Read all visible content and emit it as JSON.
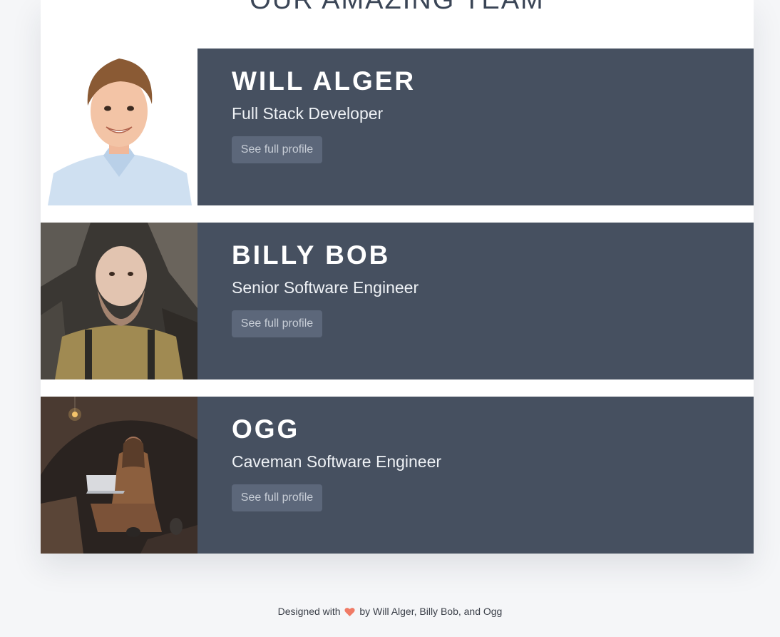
{
  "page": {
    "title": "OUR AMAZING TEAM"
  },
  "team": [
    {
      "name": "WILL ALGER",
      "role": "Full Stack Developer",
      "button_label": "See full profile",
      "photo_alt": "Will Alger"
    },
    {
      "name": "BILLY BOB",
      "role": "Senior Software Engineer",
      "button_label": "See full profile",
      "photo_alt": "Billy Bob"
    },
    {
      "name": "OGG",
      "role": "Caveman Software Engineer",
      "button_label": "See full profile",
      "photo_alt": "Ogg"
    }
  ],
  "footer": {
    "prefix": "Designed with",
    "icon": "heart-icon",
    "suffix": "by Will Alger, Billy Bob, and Ogg"
  },
  "colors": {
    "panel": "#465060",
    "button": "#5c677a",
    "heart": "#f07b66",
    "background": "#f5f6f8"
  }
}
